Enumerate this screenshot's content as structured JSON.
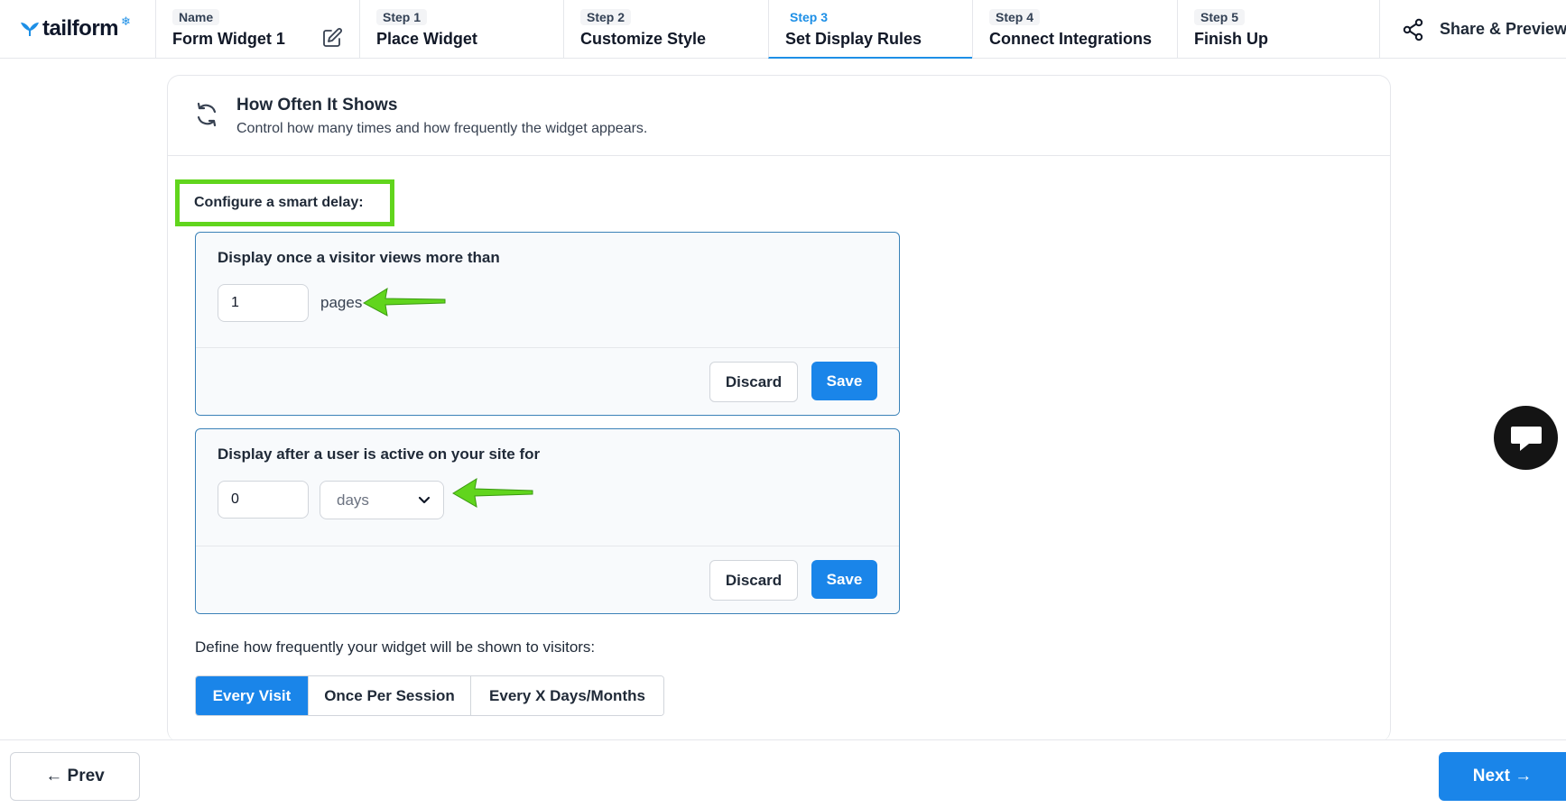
{
  "brand": {
    "name": "tailform",
    "accent": "#1d8fe6",
    "highlight": "#61d51d"
  },
  "header": {
    "name_label": "Name",
    "widget_name": "Form Widget 1",
    "steps": [
      {
        "small": "Step 1",
        "label": "Place Widget"
      },
      {
        "small": "Step 2",
        "label": "Customize Style"
      },
      {
        "small": "Step 3",
        "label": "Set Display Rules",
        "active": true
      },
      {
        "small": "Step 4",
        "label": "Connect Integrations"
      },
      {
        "small": "Step 5",
        "label": "Finish Up"
      }
    ],
    "share_label": "Share & Preview"
  },
  "section": {
    "title": "How Often It Shows",
    "subtitle": "Control how many times and how frequently the widget appears."
  },
  "smart_delay": {
    "label": "Configure a smart delay:",
    "page_rule": {
      "title": "Display once a visitor views more than",
      "value": "1",
      "unit": "pages",
      "discard_label": "Discard",
      "save_label": "Save"
    },
    "time_rule": {
      "title": "Display after a user is active on your site for",
      "value": "0",
      "unit_selected": "days",
      "discard_label": "Discard",
      "save_label": "Save"
    }
  },
  "frequency": {
    "label": "Define how frequently your widget will be shown to visitors:",
    "options": [
      "Every Visit",
      "Once Per Session",
      "Every X Days/Months"
    ],
    "selected": "Every Visit"
  },
  "footer": {
    "prev_label": "← Prev",
    "next_label": "Next →"
  },
  "icons": {
    "logo": "whale-tail-icon",
    "edit": "pencil-edit-icon",
    "share": "share-nodes-icon",
    "refresh": "refresh-icon",
    "chevron": "chevron-down-icon",
    "chat": "chat-bubble-icon"
  }
}
